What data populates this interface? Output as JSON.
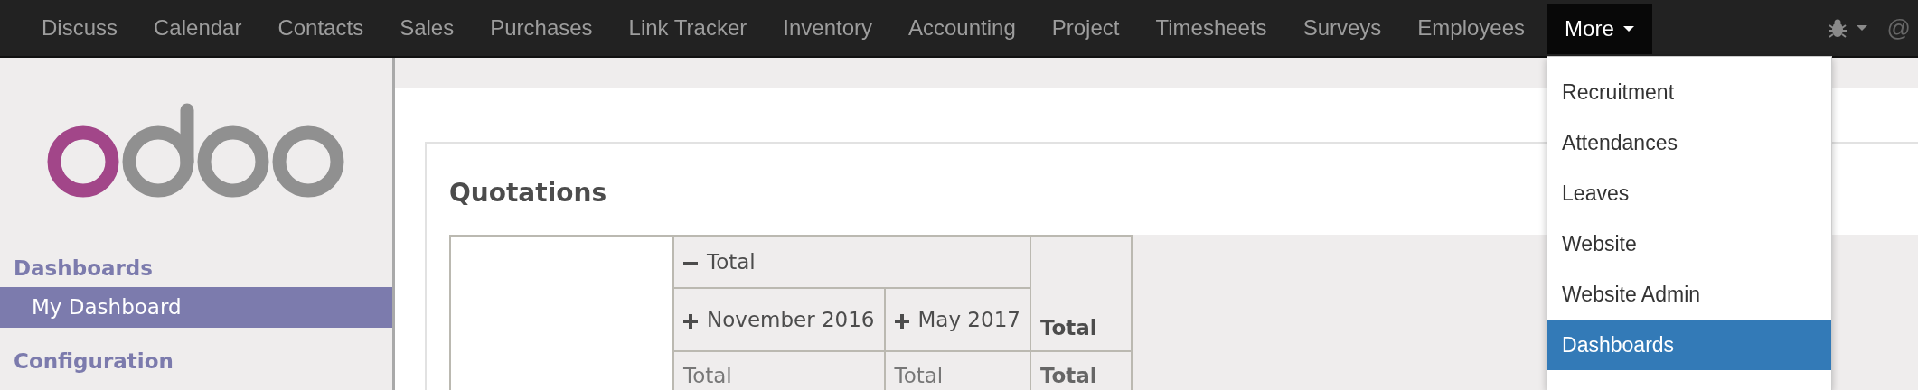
{
  "navbar": {
    "menu_items": [
      {
        "label": "Discuss"
      },
      {
        "label": "Calendar"
      },
      {
        "label": "Contacts"
      },
      {
        "label": "Sales"
      },
      {
        "label": "Purchases"
      },
      {
        "label": "Link Tracker"
      },
      {
        "label": "Inventory"
      },
      {
        "label": "Accounting"
      },
      {
        "label": "Project"
      },
      {
        "label": "Timesheets"
      },
      {
        "label": "Surveys"
      },
      {
        "label": "Employees"
      }
    ],
    "more": {
      "label": "More",
      "expanded": true,
      "items": [
        {
          "label": "Recruitment",
          "selected": false
        },
        {
          "label": "Attendances",
          "selected": false
        },
        {
          "label": "Leaves",
          "selected": false
        },
        {
          "label": "Website",
          "selected": false
        },
        {
          "label": "Website Admin",
          "selected": false
        },
        {
          "label": "Dashboards",
          "selected": true
        }
      ]
    },
    "user": "@"
  },
  "sidebar": {
    "sections": [
      {
        "title": "Dashboards",
        "items": [
          {
            "label": "My Dashboard",
            "selected": true
          }
        ]
      },
      {
        "title": "Configuration"
      }
    ]
  },
  "content": {
    "title": "Quotations",
    "pivot": {
      "column_header": {
        "label": "Total",
        "expanded": true,
        "children": [
          {
            "label": "November 2016",
            "expanded": false
          },
          {
            "label": "May 2017",
            "expanded": false
          }
        ]
      },
      "total_header": "Total",
      "rows": [
        {
          "cells": [
            "Total",
            "Total"
          ],
          "total": "Total"
        }
      ]
    }
  }
}
